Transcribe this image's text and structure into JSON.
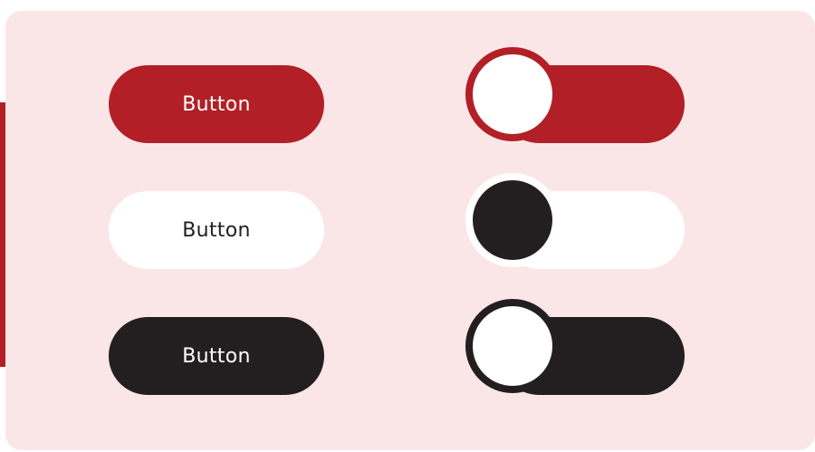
{
  "colors": {
    "primary": "#b31f26",
    "dark": "#231f20",
    "light": "#ffffff",
    "panel_background": "#fbe6e7"
  },
  "buttons": [
    {
      "variant": "red",
      "label": "Button"
    },
    {
      "variant": "white",
      "label": "Button"
    },
    {
      "variant": "black",
      "label": "Button"
    }
  ],
  "toggles": [
    {
      "variant": "red",
      "state": "off"
    },
    {
      "variant": "white",
      "state": "off"
    },
    {
      "variant": "black",
      "state": "off"
    }
  ]
}
